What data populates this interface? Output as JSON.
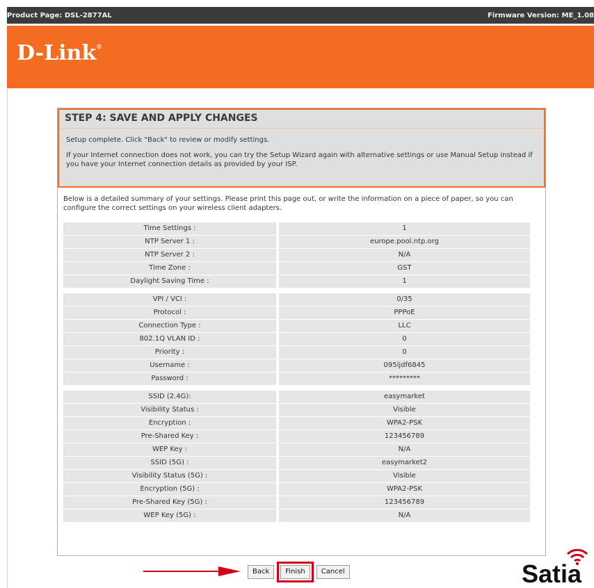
{
  "header": {
    "product": "Product Page: DSL-2877AL",
    "firmware": "Firmware Version: ME_1.08"
  },
  "brand": {
    "logo": "D-Link",
    "reg": "®"
  },
  "step": {
    "title": "STEP 4: SAVE AND APPLY CHANGES",
    "line1": "Setup complete. Click \"Back\" to review or modify settings.",
    "line2": "If your Internet connection does not work, you can try the Setup Wizard again with alternative settings or use Manual Setup instead if you have your Internet connection details as provided by your ISP."
  },
  "summary_text": "Below is a detailed summary of your settings. Please print this page out, or write the information on a piece of paper, so you can configure the correct settings on your wireless client adapters.",
  "groups": [
    [
      {
        "k": "Time Settings :",
        "v": "1"
      },
      {
        "k": "NTP Server 1 :",
        "v": "europe.pool.ntp.org"
      },
      {
        "k": "NTP Server 2 :",
        "v": "N/A"
      },
      {
        "k": "Time Zone :",
        "v": "GST"
      },
      {
        "k": "Daylight Saving Time :",
        "v": "1"
      }
    ],
    [
      {
        "k": "VPI / VCI :",
        "v": "0/35"
      },
      {
        "k": "Protocol :",
        "v": "PPPoE"
      },
      {
        "k": "Connection Type :",
        "v": "LLC"
      },
      {
        "k": "802.1Q VLAN ID :",
        "v": "0"
      },
      {
        "k": "Priority :",
        "v": "0"
      },
      {
        "k": "Username :",
        "v": "095ljdf6845"
      },
      {
        "k": "Password :",
        "v": "*********"
      }
    ],
    [
      {
        "k": "SSID (2.4G):",
        "v": "easymarket"
      },
      {
        "k": "Visibility Status :",
        "v": "Visible"
      },
      {
        "k": "Encryption :",
        "v": "WPA2-PSK"
      },
      {
        "k": "Pre-Shared Key :",
        "v": "123456789"
      },
      {
        "k": "WEP Key :",
        "v": "N/A"
      },
      {
        "k": "SSID (5G) :",
        "v": "easymarket2"
      },
      {
        "k": "Visibility Status (5G) :",
        "v": "Visible"
      },
      {
        "k": "Encryption (5G) :",
        "v": "WPA2-PSK"
      },
      {
        "k": "Pre-Shared Key (5G) :",
        "v": "123456789"
      },
      {
        "k": "WEP Key (5G) :",
        "v": "N/A"
      }
    ]
  ],
  "buttons": {
    "back": "Back",
    "finish": "Finish",
    "cancel": "Cancel"
  },
  "watermark": "Satia",
  "colors": {
    "brand": "#f36c21",
    "highlight": "#d0001a",
    "topbar": "#3b3b3b"
  }
}
